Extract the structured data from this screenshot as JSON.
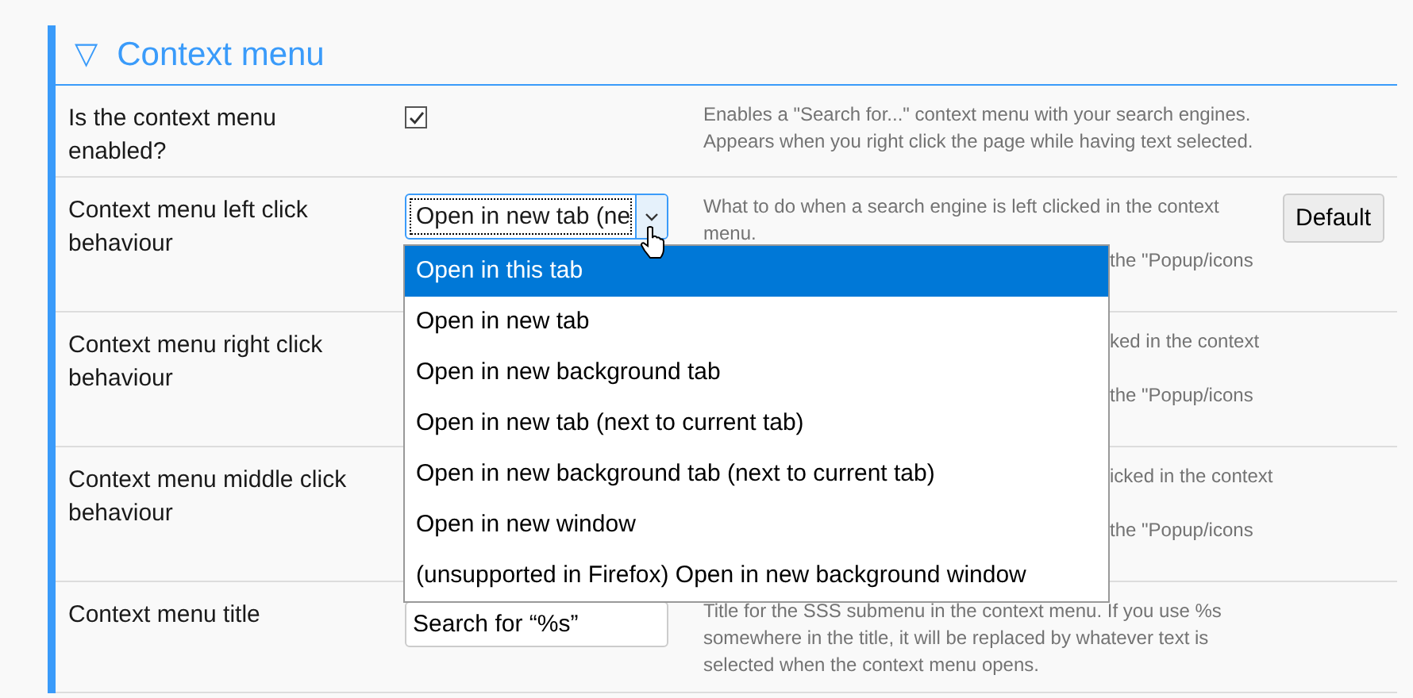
{
  "section": {
    "expander": "▽",
    "title": "Context menu"
  },
  "rows": [
    {
      "kind": "checkbox",
      "label": "Is the context menu enabled?",
      "checked": true,
      "description": [
        "Enables a \"Search for...\" context menu with your search engines.",
        "Appears when you right click the page while having text selected."
      ]
    },
    {
      "kind": "select",
      "label": "Context menu left click behaviour",
      "value": "Open in new tab (ne",
      "open": true,
      "button": "Default",
      "description": [
        "What to do when a search engine is left clicked in the context",
        "menu."
      ],
      "fragments_beside_list": [
        "the \"Popup/icons"
      ],
      "options": [
        {
          "label": "Open in this tab",
          "selected": true
        },
        {
          "label": "Open in new tab",
          "selected": false
        },
        {
          "label": "Open in new background tab",
          "selected": false
        },
        {
          "label": "Open in new tab (next to current tab)",
          "selected": false
        },
        {
          "label": "Open in new background tab (next to current tab)",
          "selected": false
        },
        {
          "label": "Open in new window",
          "selected": false
        },
        {
          "label": "(unsupported in Firefox) Open in new background window",
          "selected": false
        }
      ]
    },
    {
      "kind": "select",
      "label": "Context menu right click behaviour",
      "fragments_beside_list": [
        "ked in the context",
        "the \"Popup/icons"
      ]
    },
    {
      "kind": "select",
      "label": "Context menu middle click behaviour",
      "fragments_beside_list": [
        "icked in the context",
        "the \"Popup/icons"
      ]
    },
    {
      "kind": "text",
      "label": "Context menu title",
      "value": "Search for “%s”",
      "description": [
        "Title for the SSS submenu in the context menu. If you use %s",
        "somewhere in the title, it will be replaced by whatever text is",
        "selected when the context menu opens."
      ]
    }
  ]
}
